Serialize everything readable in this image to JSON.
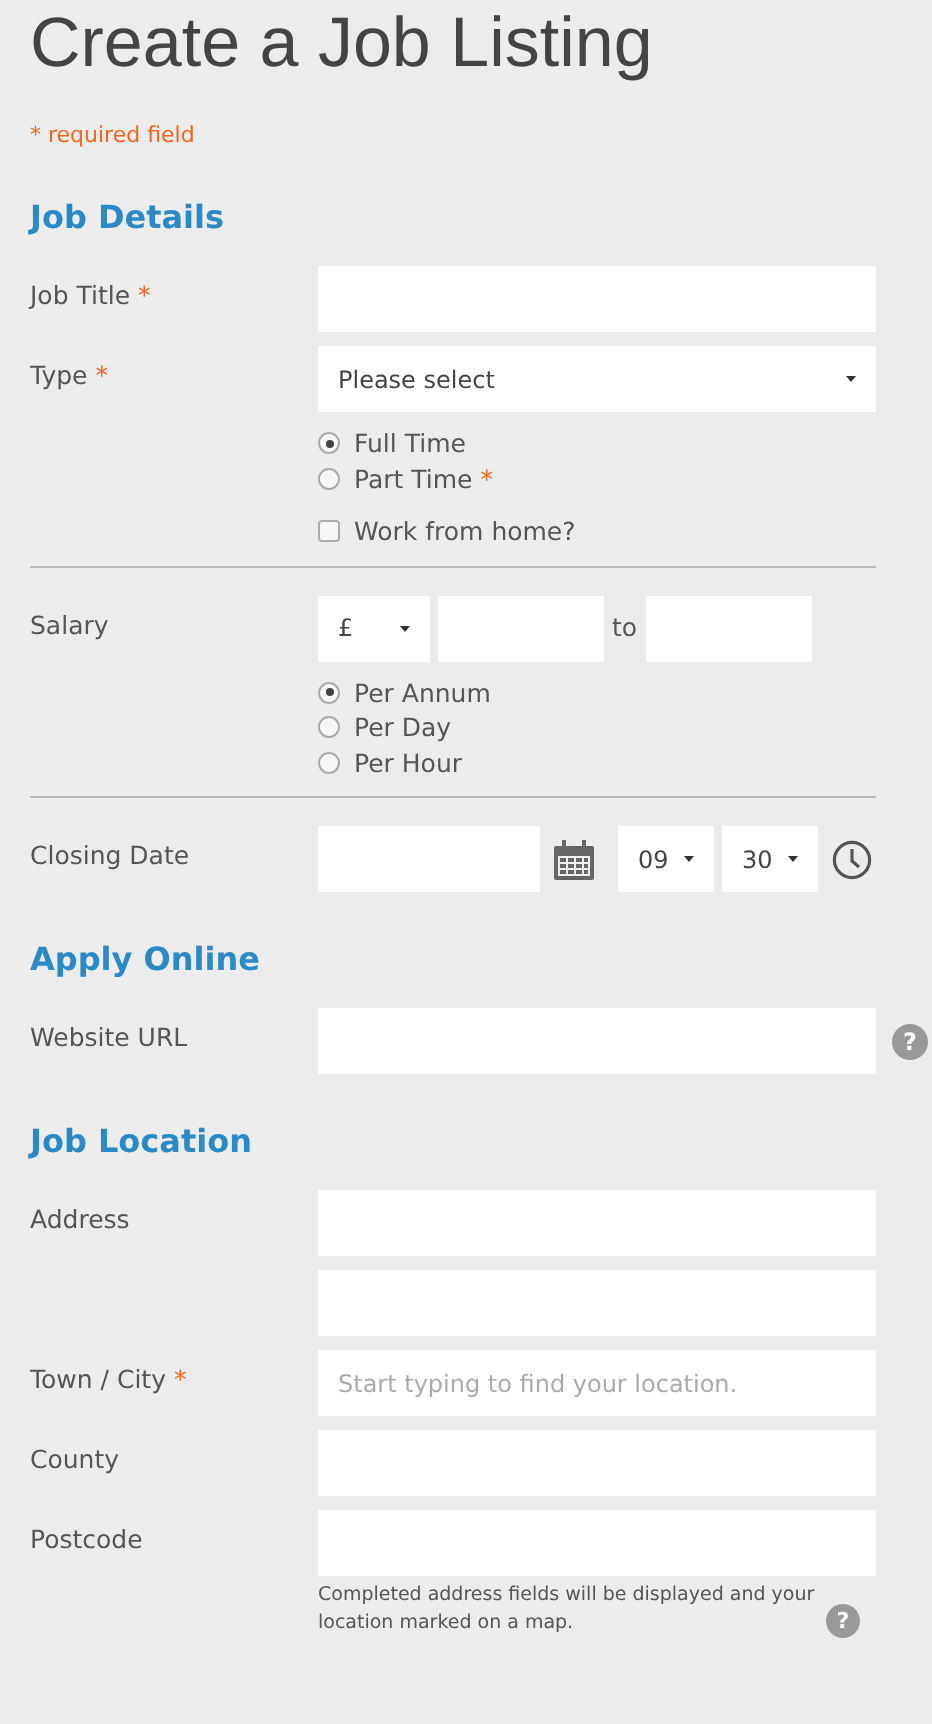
{
  "title": "Create a Job Listing",
  "required_note": "* required field",
  "sections": [
    {
      "heading": "Job Details",
      "rows": [
        {
          "kind": "text",
          "label": "Job Title",
          "required_mark": "*"
        },
        {
          "kind": "select",
          "label": "Type",
          "required_mark": "*",
          "value": "Please select"
        },
        {
          "kind": "options",
          "options": [
            {
              "kind": "radio",
              "label": "Full Time",
              "selected": true
            },
            {
              "kind": "radio",
              "label": "Part Time",
              "required_mark": "*",
              "selected": false
            },
            {
              "kind": "checkbox",
              "label": "Work from home?",
              "checked": false
            }
          ]
        },
        {
          "kind": "divider"
        },
        {
          "kind": "salary",
          "label": "Salary",
          "currency": "£",
          "joiner": "to"
        },
        {
          "kind": "options",
          "options": [
            {
              "kind": "radio",
              "label": "Per Annum",
              "selected": true
            },
            {
              "kind": "radio",
              "label": "Per Day",
              "selected": false
            },
            {
              "kind": "radio",
              "label": "Per Hour",
              "selected": false
            }
          ]
        },
        {
          "kind": "divider"
        },
        {
          "kind": "datetime",
          "label": "Closing Date",
          "hour": "09",
          "minute": "30"
        }
      ]
    },
    {
      "heading": "Apply Online",
      "rows": [
        {
          "kind": "text",
          "label": "Website URL",
          "help": "?"
        }
      ]
    },
    {
      "heading": "Job Location",
      "rows": [
        {
          "kind": "text",
          "label": "Address"
        },
        {
          "kind": "text"
        },
        {
          "kind": "text",
          "label": "Town / City",
          "required_mark": "*",
          "placeholder": "Start typing to find your location."
        },
        {
          "kind": "text",
          "label": "County"
        },
        {
          "kind": "text",
          "label": "Postcode"
        },
        {
          "kind": "note",
          "text": "Completed address fields will be displayed and your location marked on a map.",
          "help": "?"
        }
      ]
    }
  ]
}
